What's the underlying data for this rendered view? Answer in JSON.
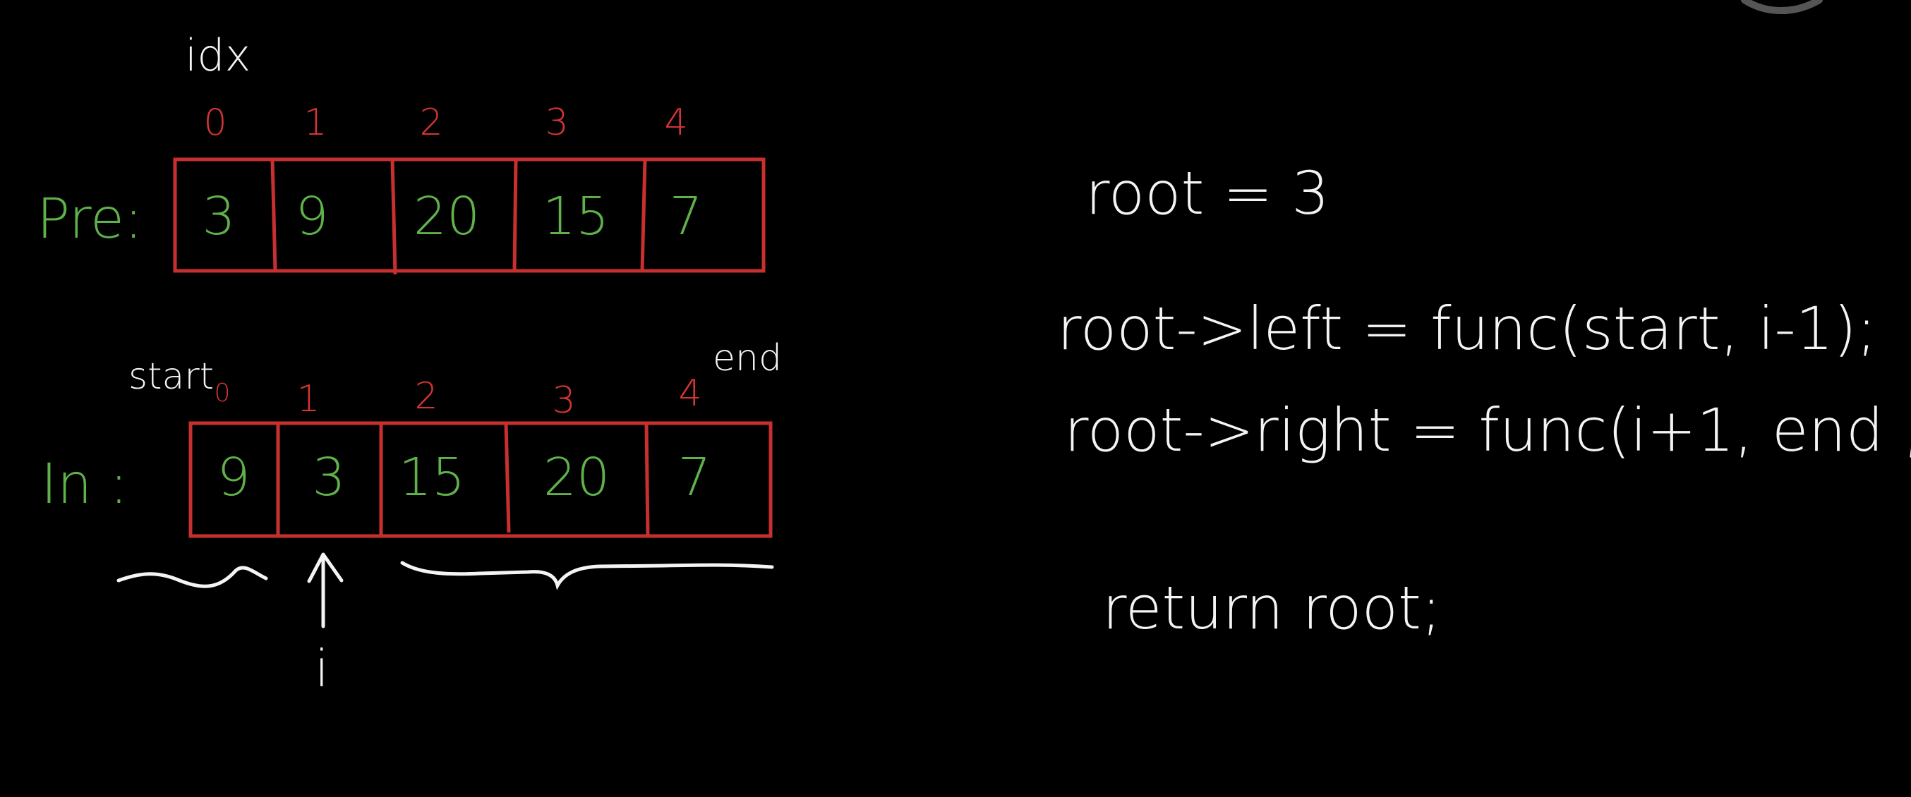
{
  "colors": {
    "background": "#000000",
    "chalk_white": "#f4f4f4",
    "array_value_green": "#5fb14a",
    "index_red": "#d63434",
    "box_red": "#c83030"
  },
  "labels": {
    "idx": "idx",
    "pre": "Pre:",
    "in": "In :",
    "start": "start",
    "end": "end",
    "i": "i"
  },
  "preorder": {
    "indices": [
      "0",
      "1",
      "2",
      "3",
      "4"
    ],
    "values": [
      "3",
      "9",
      "20",
      "15",
      "7"
    ]
  },
  "inorder": {
    "indices": [
      "0",
      "1",
      "2",
      "3",
      "4"
    ],
    "values": [
      "9",
      "3",
      "15",
      "20",
      "7"
    ]
  },
  "code": {
    "line1": "root = 3",
    "line2": "root->left = func(start, i-1);",
    "line3": "root->right = func(i+1, end ;",
    "line4": "return root;"
  },
  "icons": {
    "left_brace": "left-subtree-brace-icon",
    "right_brace": "right-subtree-brace-icon",
    "pointer": "up-arrow-icon",
    "corner": "watermark-circle-icon"
  }
}
